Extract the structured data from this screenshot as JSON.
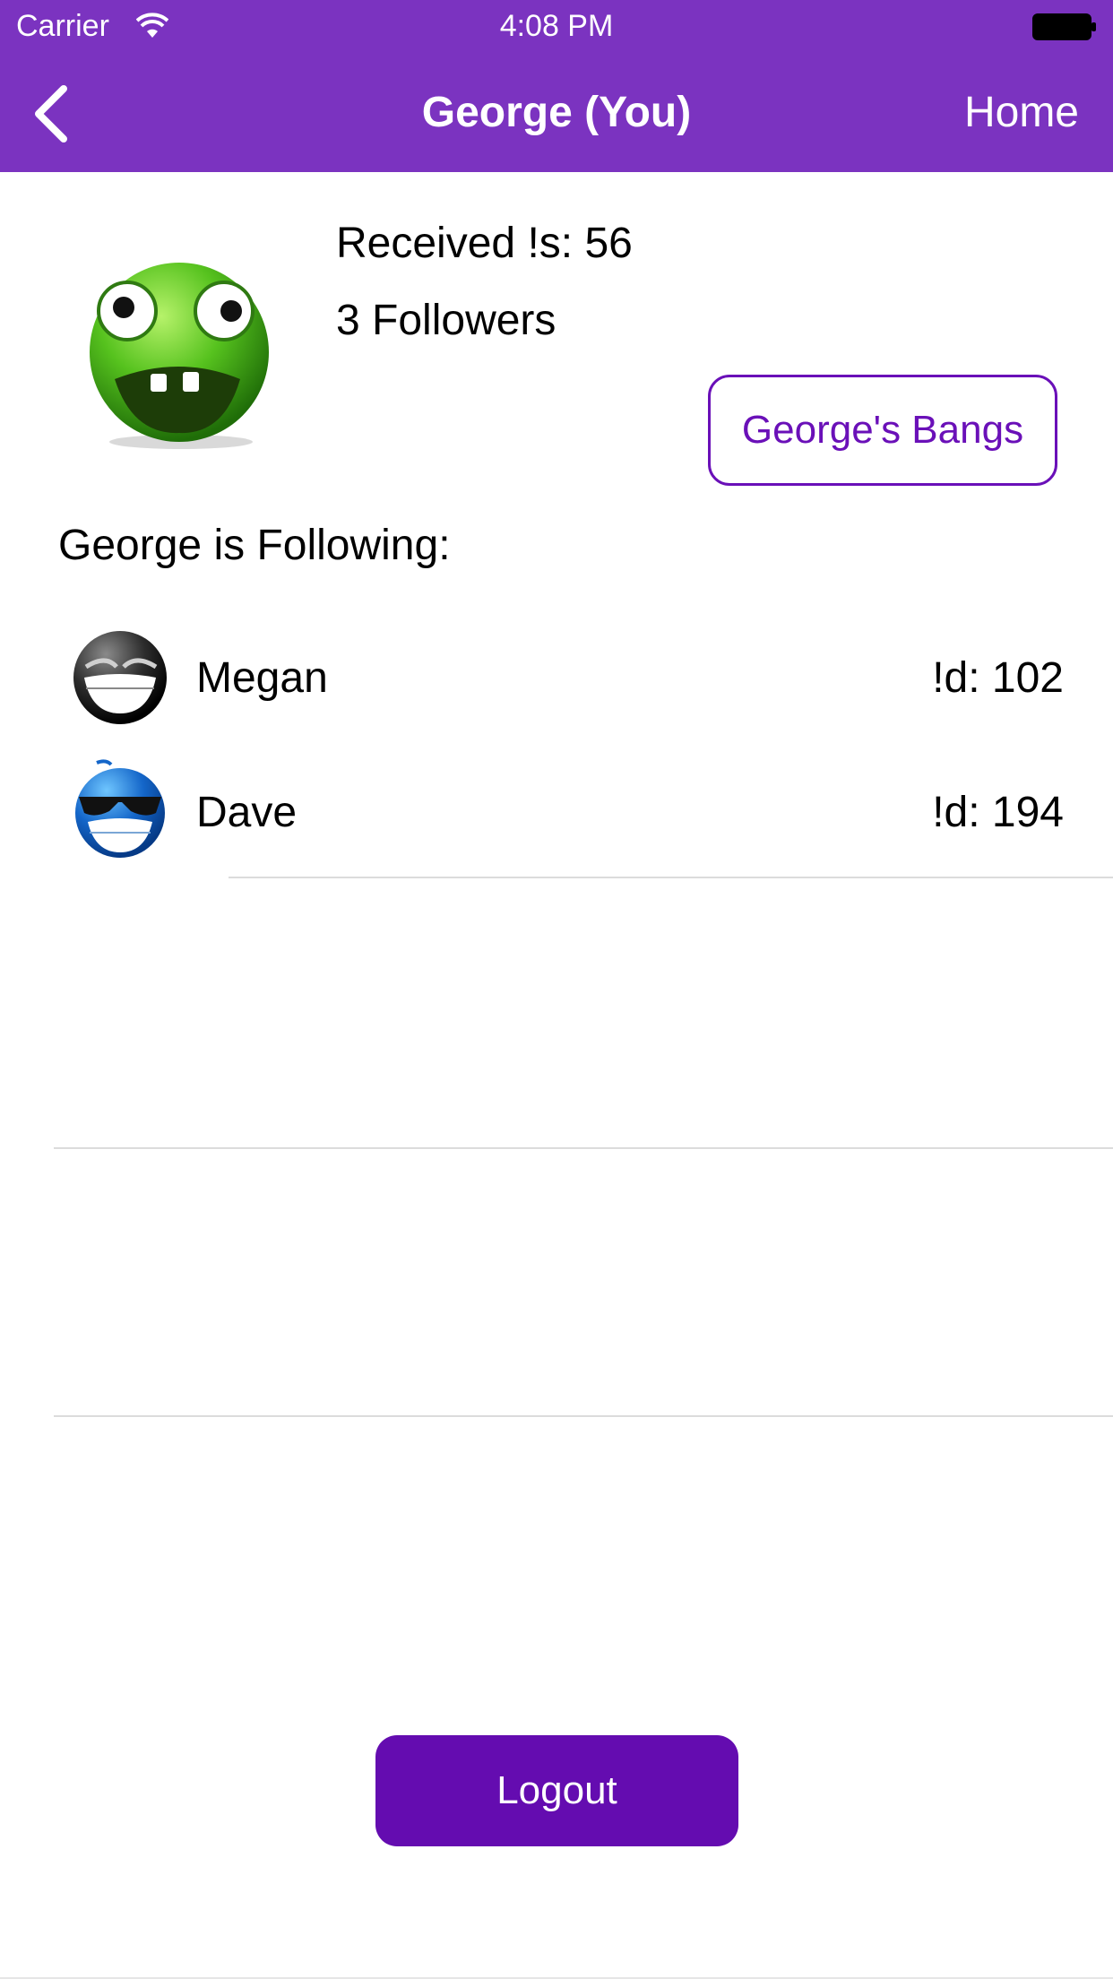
{
  "status_bar": {
    "carrier": "Carrier",
    "time": "4:08 PM"
  },
  "nav": {
    "title": "George (You)",
    "right_label": "Home",
    "background": "#7b33c0"
  },
  "profile": {
    "received_text": "Received !s: 56",
    "followers_text": "3 Followers",
    "bangs_button": "George's Bangs",
    "avatar_icon": "green-smiley-icon"
  },
  "following": {
    "heading": "George is Following:",
    "items": [
      {
        "name": "Megan",
        "count_text": "!d: 102",
        "avatar_icon": "black-grin-smiley-icon"
      },
      {
        "name": "Dave",
        "count_text": "!d: 194",
        "avatar_icon": "blue-sunglasses-smiley-icon"
      }
    ]
  },
  "logout_button": "Logout",
  "colors": {
    "accent": "#6a10b8",
    "logout": "#640cb0"
  }
}
